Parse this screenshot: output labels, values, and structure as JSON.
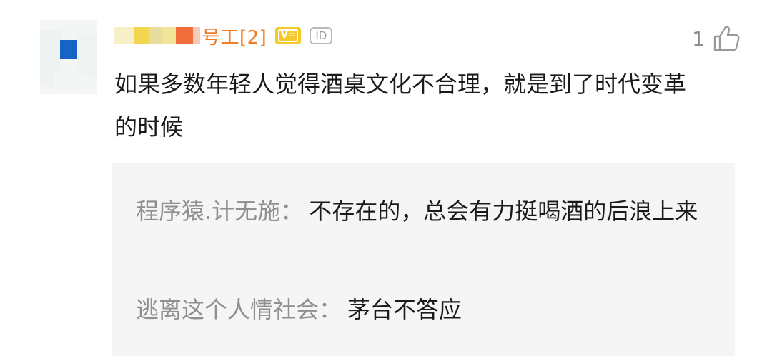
{
  "comment": {
    "author_visible_suffix": "号工[2]",
    "badges": {
      "vip_label": "V=",
      "id_label": "ID"
    },
    "like_count": "1",
    "text": "如果多数年轻人觉得酒桌文化不合理，就是到了时代变革的时候"
  },
  "replies": [
    {
      "author": "程序猿.计无施",
      "separator": "：",
      "text": "不存在的，总会有力挺喝酒的后浪上来"
    },
    {
      "author": "逃离这个人情社会",
      "separator": "：",
      "text": "茅台不答应"
    }
  ],
  "colors": {
    "username": "#f07a25",
    "vip_badge": "#f6c92a",
    "reply_author": "#8f8f8f",
    "reply_background": "#f5f5f5",
    "body_text": "#1a1a1a"
  },
  "icons": {
    "like": "thumbs-up-icon",
    "avatar": "avatar-mosaic"
  }
}
